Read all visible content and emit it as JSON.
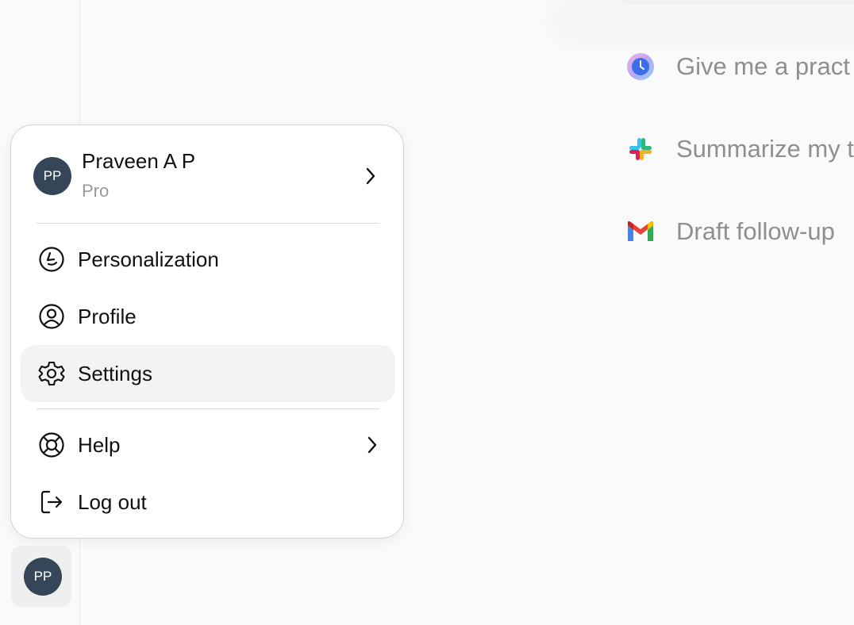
{
  "suggestions": [
    {
      "text": "Give me a pract",
      "icon": "clock-app-icon"
    },
    {
      "text": "Summarize my t",
      "icon": "slack-icon"
    },
    {
      "text": "Draft follow-up",
      "icon": "gmail-icon"
    }
  ],
  "user": {
    "initials": "PP",
    "name": "Praveen A P",
    "plan": "Pro"
  },
  "menu": {
    "personalization": "Personalization",
    "profile": "Profile",
    "settings": "Settings",
    "help": "Help",
    "logout": "Log out"
  },
  "colors": {
    "avatar": "#364659",
    "active_item": "#f3f3f3",
    "suggestion_text": "#8f8f8f"
  }
}
